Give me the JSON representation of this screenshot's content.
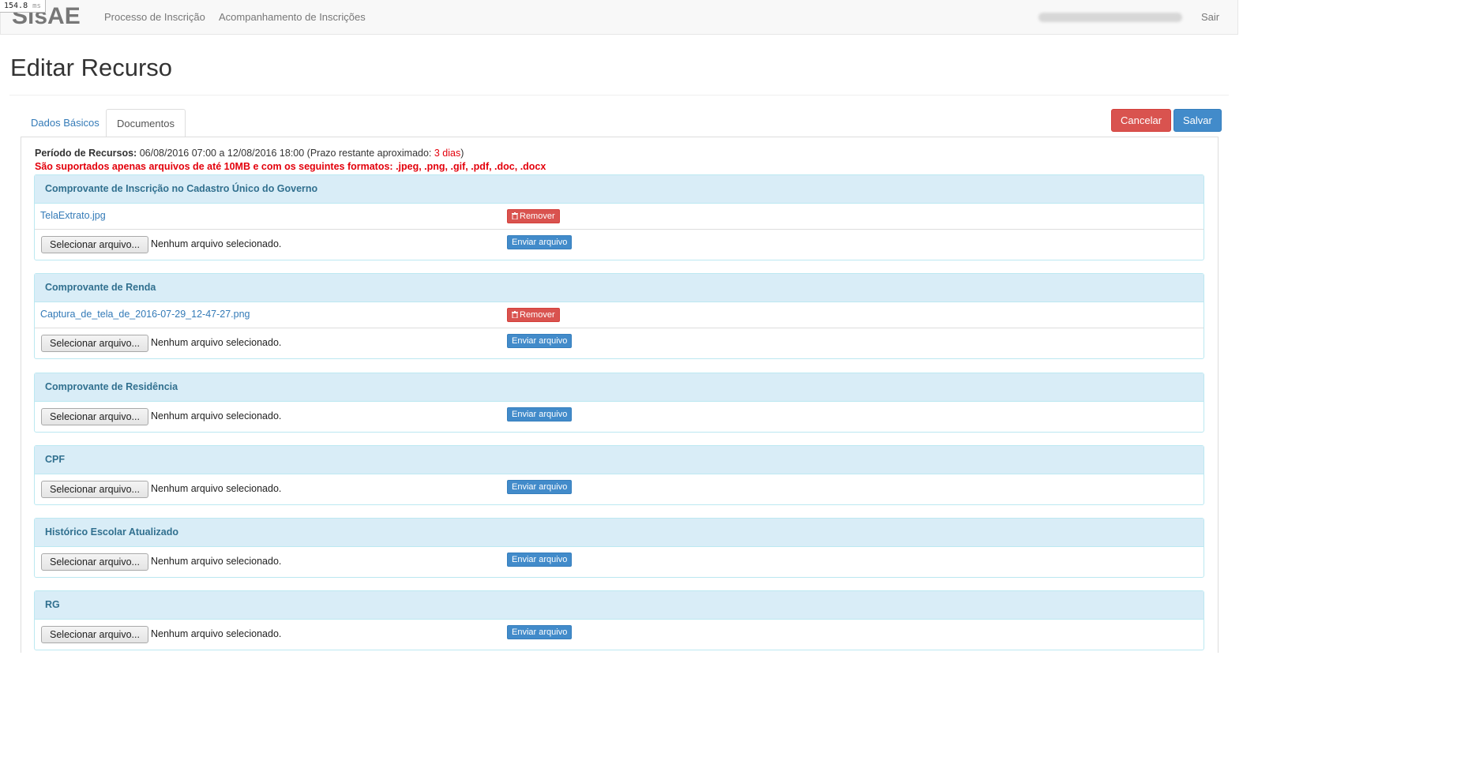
{
  "navbar": {
    "brand": "SisAE",
    "links": [
      "Processo de Inscrição",
      "Acompanhamento de Inscrições"
    ],
    "logout": "Sair",
    "timing_value": "154.8",
    "timing_unit": "ms"
  },
  "page": {
    "title": "Editar Recurso"
  },
  "tabs": [
    {
      "label": "Dados Básicos",
      "active": false
    },
    {
      "label": "Documentos",
      "active": true
    }
  ],
  "actions": {
    "cancel_label": "Cancelar",
    "save_label": "Salvar"
  },
  "info": {
    "period_label": "Período de Recursos:",
    "period_value": "06/08/2016 07:00 a 12/08/2016 18:00 (Prazo restante aproximado: ",
    "remaining": "3 dias",
    "close_paren": ")",
    "warning": "São suportados apenas arquivos de até 10MB e com os seguintes formatos: .jpeg, .png, .gif, .pdf, .doc, .docx"
  },
  "common": {
    "select_file_label": "Selecionar arquivo...",
    "no_file_label": "Nenhum arquivo selecionado.",
    "send_label": "Enviar arquivo",
    "remove_label": "Remover"
  },
  "documents": [
    {
      "title": "Comprovante de Inscrição no Cadastro Único do Governo",
      "file": "TelaExtrato.jpg"
    },
    {
      "title": "Comprovante de Renda",
      "file": "Captura_de_tela_de_2016-07-29_12-47-27.png"
    },
    {
      "title": "Comprovante de Residência",
      "file": null
    },
    {
      "title": "CPF",
      "file": null
    },
    {
      "title": "Histórico Escolar Atualizado",
      "file": null
    },
    {
      "title": "RG",
      "file": null
    }
  ],
  "colors": {
    "primary": "#428bca",
    "danger": "#d9534f",
    "panel_heading": "#d9edf7",
    "alert_red": "#e3000b"
  }
}
